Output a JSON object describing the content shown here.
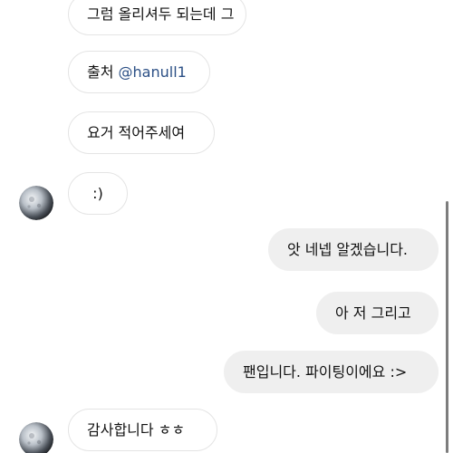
{
  "messages": [
    {
      "direction": "received",
      "text": "그럼 올리셔두 되는데 그"
    },
    {
      "direction": "received",
      "prefix": "출처 ",
      "mention": "@hanull1"
    },
    {
      "direction": "received",
      "text": "요거 적어주세여"
    },
    {
      "direction": "received",
      "text": ":)"
    },
    {
      "direction": "sent",
      "text": "앗 네넵 알겠습니다."
    },
    {
      "direction": "sent",
      "text": "아 저 그리고"
    },
    {
      "direction": "sent",
      "text": "팬입니다. 파이팅이에요 :>"
    },
    {
      "direction": "received",
      "text": "감사합니다 ㅎㅎ"
    }
  ],
  "avatar_icon": "moon-avatar-icon",
  "colors": {
    "sent_bubble": "#efefef",
    "received_border": "#e4e4e4",
    "mention": "#2b4f85",
    "scrollbar": "#7d7d7d"
  }
}
